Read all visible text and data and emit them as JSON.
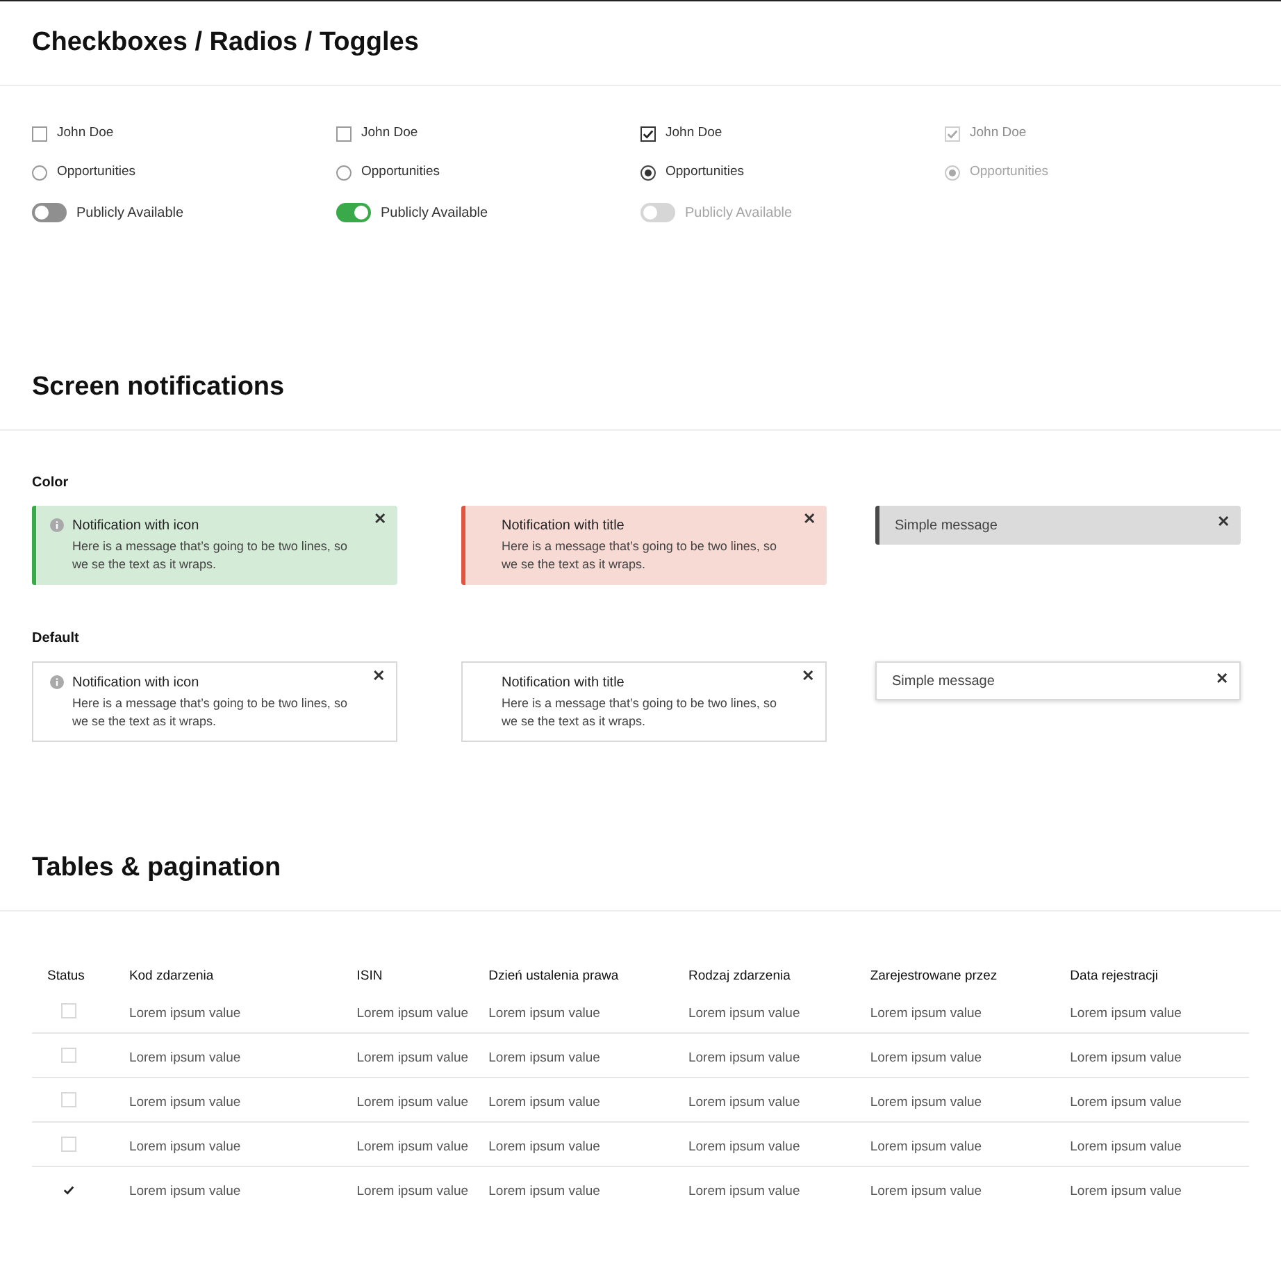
{
  "sections": [
    {
      "title": "Checkboxes / Radios / Toggles"
    },
    {
      "title": "Screen notifications"
    },
    {
      "title": "Tables & pagination"
    }
  ],
  "controls": [
    {
      "checkbox": {
        "label": "John Doe",
        "checked": false,
        "disabled": false
      },
      "radio": {
        "label": "Opportunities",
        "checked": false,
        "disabled": false
      },
      "toggle": {
        "label": "Publicly Available",
        "on": false,
        "disabled": false
      }
    },
    {
      "checkbox": {
        "label": "John Doe",
        "checked": false,
        "disabled": false
      },
      "radio": {
        "label": "Opportunities",
        "checked": false,
        "disabled": false
      },
      "toggle": {
        "label": "Publicly Available",
        "on": true,
        "disabled": false
      }
    },
    {
      "checkbox": {
        "label": "John Doe",
        "checked": true,
        "disabled": false
      },
      "radio": {
        "label": "Opportunities",
        "checked": true,
        "disabled": false
      },
      "toggle": {
        "label": "Publicly Available",
        "on": false,
        "disabled": true
      }
    },
    {
      "checkbox": {
        "label": "John Doe",
        "checked": true,
        "disabled": true
      },
      "radio": {
        "label": "Opportunities",
        "checked": true,
        "disabled": true
      }
    }
  ],
  "notification_groups": [
    {
      "label": "Color",
      "items": [
        {
          "kind": "icon",
          "color": "#3aa94a",
          "title": "Notification with icon",
          "message": "Here is a message that’s going to be two lines, so we se the text as it wraps.",
          "close": "✕"
        },
        {
          "kind": "title",
          "color": "#e0553f",
          "title": "Notification with title",
          "message": "Here is a message that’s going to be two lines, so we se the text as it wraps.",
          "close": "✕"
        },
        {
          "kind": "simple",
          "color": "#4a4a4a",
          "message": "Simple message",
          "close": "✕"
        }
      ]
    },
    {
      "label": "Default",
      "items": [
        {
          "kind": "icon",
          "title": "Notification with icon",
          "message": "Here is a message that’s going to be two lines, so we se the text as it wraps.",
          "close": "✕"
        },
        {
          "kind": "title",
          "title": "Notification with title",
          "message": "Here is a message that’s going to be two lines, so we se the text as it wraps.",
          "close": "✕"
        },
        {
          "kind": "simple",
          "message": "Simple message",
          "close": "✕"
        }
      ]
    }
  ],
  "table": {
    "columns": [
      "Status",
      "Kod zdarzenia",
      "ISIN",
      "Dzień ustalenia prawa",
      "Rodzaj zdarzenia",
      "Zarejestrowane przez",
      "Data rejestracji"
    ],
    "rows": [
      {
        "selected": false,
        "cells": [
          "",
          "Lorem ipsum value",
          "Lorem ipsum value",
          "Lorem ipsum value",
          "Lorem ipsum value",
          "Lorem ipsum value",
          "Lorem ipsum value"
        ]
      },
      {
        "selected": false,
        "cells": [
          "",
          "Lorem ipsum value",
          "Lorem ipsum value",
          "Lorem ipsum value",
          "Lorem ipsum value",
          "Lorem ipsum value",
          "Lorem ipsum value"
        ]
      },
      {
        "selected": false,
        "cells": [
          "",
          "Lorem ipsum value",
          "Lorem ipsum value",
          "Lorem ipsum value",
          "Lorem ipsum value",
          "Lorem ipsum value",
          "Lorem ipsum value"
        ]
      },
      {
        "selected": false,
        "cells": [
          "",
          "Lorem ipsum value",
          "Lorem ipsum value",
          "Lorem ipsum value",
          "Lorem ipsum value",
          "Lorem ipsum value",
          "Lorem ipsum value"
        ]
      },
      {
        "selected": true,
        "cells": [
          "",
          "Lorem ipsum value",
          "Lorem ipsum value",
          "Lorem ipsum value",
          "Lorem ipsum value",
          "Lorem ipsum value",
          "Lorem ipsum value"
        ]
      }
    ]
  }
}
